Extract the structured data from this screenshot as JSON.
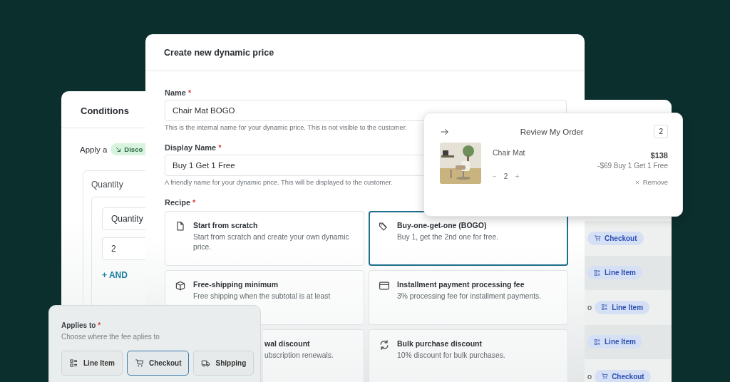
{
  "conditions": {
    "title": "Conditions",
    "apply_label": "Apply a",
    "type_pill": "Disco",
    "group_title": "Quantity",
    "select_value": "Quantity",
    "input_value": "2",
    "add_link": "+ AND"
  },
  "assignments": [
    {
      "label": "Checkout",
      "kind": "cart"
    },
    {
      "label": "Line Item",
      "kind": "list"
    },
    {
      "prefix": "o",
      "label": "Line Item",
      "kind": "list"
    },
    {
      "label": "Line Item",
      "kind": "list"
    },
    {
      "prefix": "o",
      "label": "Checkout",
      "kind": "cart"
    }
  ],
  "main": {
    "title": "Create new dynamic price",
    "fields": [
      {
        "label": "Name",
        "required_mark": "*",
        "value": "Chair Mat BOGO",
        "help": "This is the internal name for your dynamic price. This is not visible to the customer."
      },
      {
        "label": "Display Name",
        "required_mark": "*",
        "value": "Buy 1 Get 1 Free",
        "help": "A friendly name for your dynamic price. This will be displayed to the customer."
      }
    ],
    "recipe_label": "Recipe",
    "recipe_required_mark": "*",
    "recipes": [
      {
        "kind": "file",
        "title": "Start from scratch",
        "description": "Start from scratch and create your own dynamic price.",
        "selected": false
      },
      {
        "kind": "tag",
        "title": "Buy-one-get-one (BOGO)",
        "description": "Buy 1, get the 2nd one for free.",
        "selected": true
      },
      {
        "kind": "package",
        "title": "Free-shipping minimum",
        "description": "Free shipping when the subtotal is at least",
        "selected": false
      },
      {
        "kind": "card",
        "title": "Installment payment processing fee",
        "description": "3% processing fee for installment payments.",
        "selected": false
      },
      {
        "kind": "covered",
        "title": "wal discount",
        "description": "ubscription renewals.",
        "selected": false
      },
      {
        "kind": "refresh",
        "title": "Bulk purchase discount",
        "description": "10% discount for bulk purchases.",
        "selected": false
      }
    ]
  },
  "review": {
    "title": "Review My Order",
    "count": "2",
    "item": {
      "kind": "picture",
      "name": "Chair Mat",
      "quantity": "2",
      "decrease": "−",
      "increase": "+",
      "price": "$138",
      "discount": "-$69 Buy 1 Get 1 Free",
      "remove": "Remove"
    }
  },
  "applies": {
    "label": "Applies to",
    "required_mark": "*",
    "help": "Choose where the fee aplies to",
    "options": [
      {
        "kind": "list",
        "label": "Line Item",
        "selected": false
      },
      {
        "kind": "cart",
        "label": "Checkout",
        "selected": true
      },
      {
        "kind": "truck",
        "label": "Shipping",
        "selected": false
      }
    ]
  }
}
